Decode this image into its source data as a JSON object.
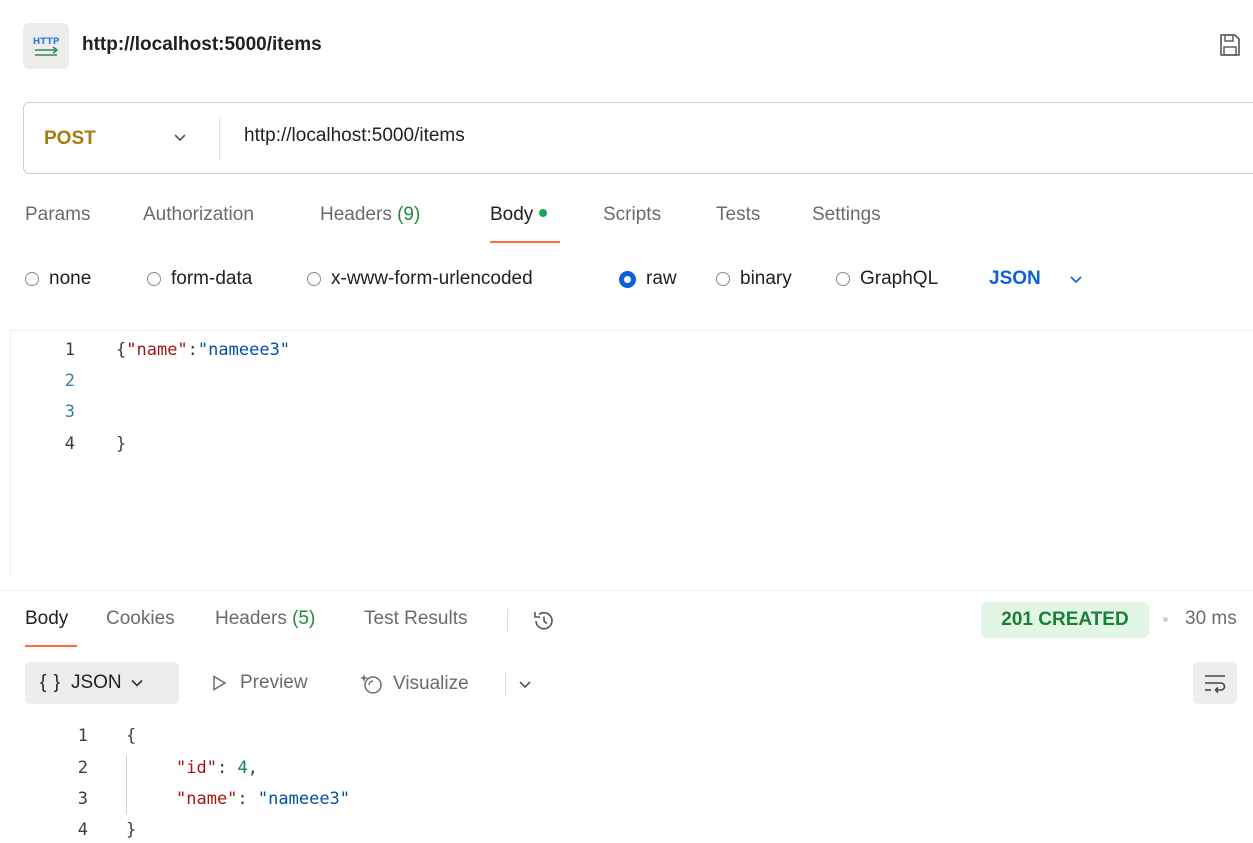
{
  "title_bar": {
    "badge_text": "HTTP",
    "title": "http://localhost:5000/items"
  },
  "request": {
    "method": "POST",
    "url": "http://localhost:5000/items",
    "tabs": [
      {
        "label": "Params",
        "count": ""
      },
      {
        "label": "Authorization",
        "count": ""
      },
      {
        "label": "Headers",
        "count": "(9)"
      },
      {
        "label": "Body",
        "count": ""
      },
      {
        "label": "Scripts",
        "count": ""
      },
      {
        "label": "Tests",
        "count": ""
      },
      {
        "label": "Settings",
        "count": ""
      }
    ],
    "body_types": [
      "none",
      "form-data",
      "x-www-form-urlencoded",
      "raw",
      "binary",
      "GraphQL"
    ],
    "selected_body_type": "raw",
    "format": "JSON",
    "body_lines": [
      {
        "n": "1",
        "key": "\"name\"",
        "colon": ":",
        "value": "\"nameee3\""
      },
      {
        "n": "2"
      },
      {
        "n": "3"
      },
      {
        "n": "4",
        "text": "}"
      }
    ],
    "open_brace": "{"
  },
  "response": {
    "tabs": [
      {
        "label": "Body",
        "count": ""
      },
      {
        "label": "Cookies",
        "count": ""
      },
      {
        "label": "Headers",
        "count": "(5)"
      },
      {
        "label": "Test Results",
        "count": ""
      }
    ],
    "status": "201 CREATED",
    "time": "30 ms",
    "format_button": "JSON",
    "format_braces": "{ }",
    "preview_label": "Preview",
    "visualize_label": "Visualize",
    "lines": [
      {
        "n": "1",
        "text": "{"
      },
      {
        "n": "2",
        "key": "\"id\"",
        "colon": ": ",
        "value": "4",
        "trail": ","
      },
      {
        "n": "3",
        "key": "\"name\"",
        "colon": ": ",
        "value": "\"nameee3\""
      },
      {
        "n": "4",
        "text": "}"
      }
    ]
  },
  "colors": {
    "accent": "#ff6c37",
    "method": "#a87b10",
    "link": "#0d5fdc",
    "success": "#1a7f37"
  },
  "icons": [
    "http-file-icon",
    "save-icon",
    "chevron-down-icon",
    "history-icon",
    "play-icon",
    "visualize-icon",
    "wrap-lines-icon"
  ]
}
